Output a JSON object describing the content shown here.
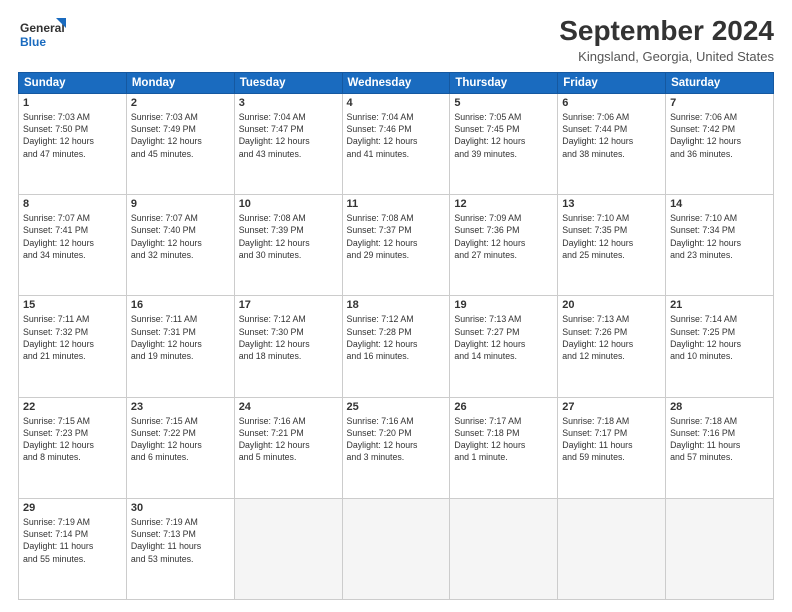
{
  "logo": {
    "line1": "General",
    "line2": "Blue"
  },
  "title": "September 2024",
  "subtitle": "Kingsland, Georgia, United States",
  "columns": [
    "Sunday",
    "Monday",
    "Tuesday",
    "Wednesday",
    "Thursday",
    "Friday",
    "Saturday"
  ],
  "weeks": [
    [
      {
        "day": "1",
        "info": "Sunrise: 7:03 AM\nSunset: 7:50 PM\nDaylight: 12 hours\nand 47 minutes."
      },
      {
        "day": "2",
        "info": "Sunrise: 7:03 AM\nSunset: 7:49 PM\nDaylight: 12 hours\nand 45 minutes."
      },
      {
        "day": "3",
        "info": "Sunrise: 7:04 AM\nSunset: 7:47 PM\nDaylight: 12 hours\nand 43 minutes."
      },
      {
        "day": "4",
        "info": "Sunrise: 7:04 AM\nSunset: 7:46 PM\nDaylight: 12 hours\nand 41 minutes."
      },
      {
        "day": "5",
        "info": "Sunrise: 7:05 AM\nSunset: 7:45 PM\nDaylight: 12 hours\nand 39 minutes."
      },
      {
        "day": "6",
        "info": "Sunrise: 7:06 AM\nSunset: 7:44 PM\nDaylight: 12 hours\nand 38 minutes."
      },
      {
        "day": "7",
        "info": "Sunrise: 7:06 AM\nSunset: 7:42 PM\nDaylight: 12 hours\nand 36 minutes."
      }
    ],
    [
      {
        "day": "8",
        "info": "Sunrise: 7:07 AM\nSunset: 7:41 PM\nDaylight: 12 hours\nand 34 minutes."
      },
      {
        "day": "9",
        "info": "Sunrise: 7:07 AM\nSunset: 7:40 PM\nDaylight: 12 hours\nand 32 minutes."
      },
      {
        "day": "10",
        "info": "Sunrise: 7:08 AM\nSunset: 7:39 PM\nDaylight: 12 hours\nand 30 minutes."
      },
      {
        "day": "11",
        "info": "Sunrise: 7:08 AM\nSunset: 7:37 PM\nDaylight: 12 hours\nand 29 minutes."
      },
      {
        "day": "12",
        "info": "Sunrise: 7:09 AM\nSunset: 7:36 PM\nDaylight: 12 hours\nand 27 minutes."
      },
      {
        "day": "13",
        "info": "Sunrise: 7:10 AM\nSunset: 7:35 PM\nDaylight: 12 hours\nand 25 minutes."
      },
      {
        "day": "14",
        "info": "Sunrise: 7:10 AM\nSunset: 7:34 PM\nDaylight: 12 hours\nand 23 minutes."
      }
    ],
    [
      {
        "day": "15",
        "info": "Sunrise: 7:11 AM\nSunset: 7:32 PM\nDaylight: 12 hours\nand 21 minutes."
      },
      {
        "day": "16",
        "info": "Sunrise: 7:11 AM\nSunset: 7:31 PM\nDaylight: 12 hours\nand 19 minutes."
      },
      {
        "day": "17",
        "info": "Sunrise: 7:12 AM\nSunset: 7:30 PM\nDaylight: 12 hours\nand 18 minutes."
      },
      {
        "day": "18",
        "info": "Sunrise: 7:12 AM\nSunset: 7:28 PM\nDaylight: 12 hours\nand 16 minutes."
      },
      {
        "day": "19",
        "info": "Sunrise: 7:13 AM\nSunset: 7:27 PM\nDaylight: 12 hours\nand 14 minutes."
      },
      {
        "day": "20",
        "info": "Sunrise: 7:13 AM\nSunset: 7:26 PM\nDaylight: 12 hours\nand 12 minutes."
      },
      {
        "day": "21",
        "info": "Sunrise: 7:14 AM\nSunset: 7:25 PM\nDaylight: 12 hours\nand 10 minutes."
      }
    ],
    [
      {
        "day": "22",
        "info": "Sunrise: 7:15 AM\nSunset: 7:23 PM\nDaylight: 12 hours\nand 8 minutes."
      },
      {
        "day": "23",
        "info": "Sunrise: 7:15 AM\nSunset: 7:22 PM\nDaylight: 12 hours\nand 6 minutes."
      },
      {
        "day": "24",
        "info": "Sunrise: 7:16 AM\nSunset: 7:21 PM\nDaylight: 12 hours\nand 5 minutes."
      },
      {
        "day": "25",
        "info": "Sunrise: 7:16 AM\nSunset: 7:20 PM\nDaylight: 12 hours\nand 3 minutes."
      },
      {
        "day": "26",
        "info": "Sunrise: 7:17 AM\nSunset: 7:18 PM\nDaylight: 12 hours\nand 1 minute."
      },
      {
        "day": "27",
        "info": "Sunrise: 7:18 AM\nSunset: 7:17 PM\nDaylight: 11 hours\nand 59 minutes."
      },
      {
        "day": "28",
        "info": "Sunrise: 7:18 AM\nSunset: 7:16 PM\nDaylight: 11 hours\nand 57 minutes."
      }
    ],
    [
      {
        "day": "29",
        "info": "Sunrise: 7:19 AM\nSunset: 7:14 PM\nDaylight: 11 hours\nand 55 minutes."
      },
      {
        "day": "30",
        "info": "Sunrise: 7:19 AM\nSunset: 7:13 PM\nDaylight: 11 hours\nand 53 minutes."
      },
      {
        "day": "",
        "info": ""
      },
      {
        "day": "",
        "info": ""
      },
      {
        "day": "",
        "info": ""
      },
      {
        "day": "",
        "info": ""
      },
      {
        "day": "",
        "info": ""
      }
    ]
  ]
}
